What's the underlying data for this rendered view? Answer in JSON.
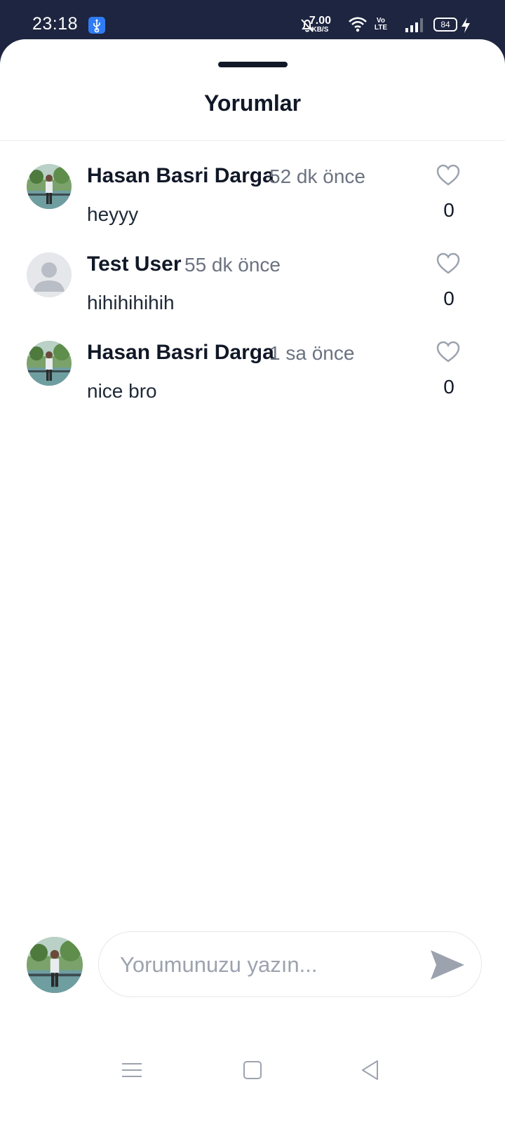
{
  "status_bar": {
    "time": "23:18",
    "net_speed_value": "7.00",
    "net_speed_unit": "KB/S",
    "volte_top": "Vo",
    "volte_bottom": "LTE",
    "battery": "84"
  },
  "sheet": {
    "title": "Yorumlar"
  },
  "comments": [
    {
      "author": "Hasan Basri Darga",
      "time": "52 dk önce",
      "text": "heyyy",
      "likes": "0",
      "avatar": "photo"
    },
    {
      "author": "Test User",
      "time": "55 dk önce",
      "text": "hihihihihih",
      "likes": "0",
      "avatar": "default"
    },
    {
      "author": "Hasan Basri Darga",
      "time": "1 sa önce",
      "text": "nice bro",
      "likes": "0",
      "avatar": "photo"
    }
  ],
  "composer": {
    "placeholder": "Yorumunuzu yazın...",
    "value": ""
  },
  "colors": {
    "status_bar_bg": "#1e2540",
    "heart_outline": "#9ca3af",
    "send_icon": "#9ca3af"
  }
}
